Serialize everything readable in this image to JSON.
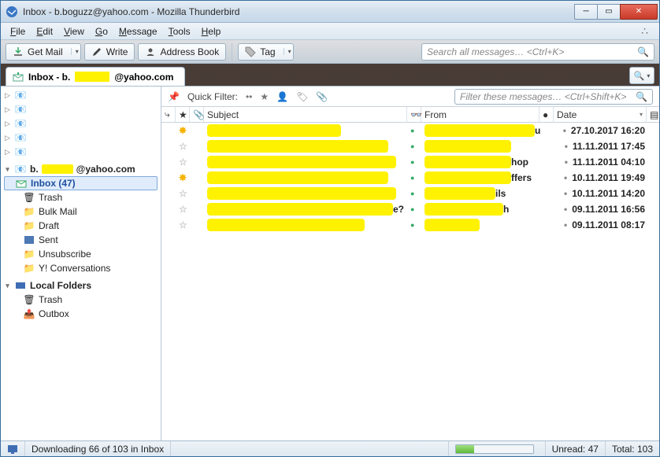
{
  "window": {
    "title": "Inbox - b.boguzz@yahoo.com - Mozilla Thunderbird"
  },
  "menus": [
    "File",
    "Edit",
    "View",
    "Go",
    "Message",
    "Tools",
    "Help"
  ],
  "toolbar": {
    "get_mail": "Get Mail",
    "write": "Write",
    "address_book": "Address Book",
    "tag": "Tag",
    "search_placeholder": "Search all messages… <Ctrl+K>"
  },
  "tab": {
    "prefix": "Inbox - b.",
    "suffix": "@yahoo.com"
  },
  "quickfilter": {
    "label": "Quick Filter:",
    "filter_placeholder": "Filter these messages… <Ctrl+Shift+K>"
  },
  "columns": {
    "subject": "Subject",
    "from": "From",
    "date": "Date"
  },
  "folder_tree": {
    "account_prefix": "b.",
    "account_suffix": "@yahoo.com",
    "inbox": "Inbox (47)",
    "trash": "Trash",
    "bulk": "Bulk Mail",
    "draft": "Draft",
    "sent": "Sent",
    "unsub": "Unsubscribe",
    "yconv": "Y! Conversations",
    "local": "Local Folders",
    "ltrash": "Trash",
    "outbox": "Outbox"
  },
  "messages": [
    {
      "starred": true,
      "date": "27.10.2017 16:20",
      "from_tail": "u",
      "sw": 170,
      "fw": 140
    },
    {
      "starred": false,
      "date": "11.11.2011 17:45",
      "from_tail": "",
      "sw": 230,
      "fw": 110
    },
    {
      "starred": false,
      "date": "11.11.2011 04:10",
      "from_tail": "hop",
      "sw": 240,
      "fw": 110
    },
    {
      "starred": true,
      "date": "10.11.2011 19:49",
      "from_tail": "ffers",
      "sw": 230,
      "fw": 110
    },
    {
      "starred": false,
      "date": "10.11.2011 14:20",
      "from_tail": "ils",
      "sw": 240,
      "fw": 90
    },
    {
      "starred": false,
      "date": "09.11.2011 16:56",
      "from_tail": "h",
      "sw": 260,
      "fw": 100,
      "subj_tail": "e?"
    },
    {
      "starred": false,
      "date": "09.11.2011 08:17",
      "from_tail": "",
      "sw": 200,
      "fw": 70
    }
  ],
  "status": {
    "downloading": "Downloading 66 of 103 in Inbox",
    "unread": "Unread: 47",
    "total": "Total: 103"
  }
}
